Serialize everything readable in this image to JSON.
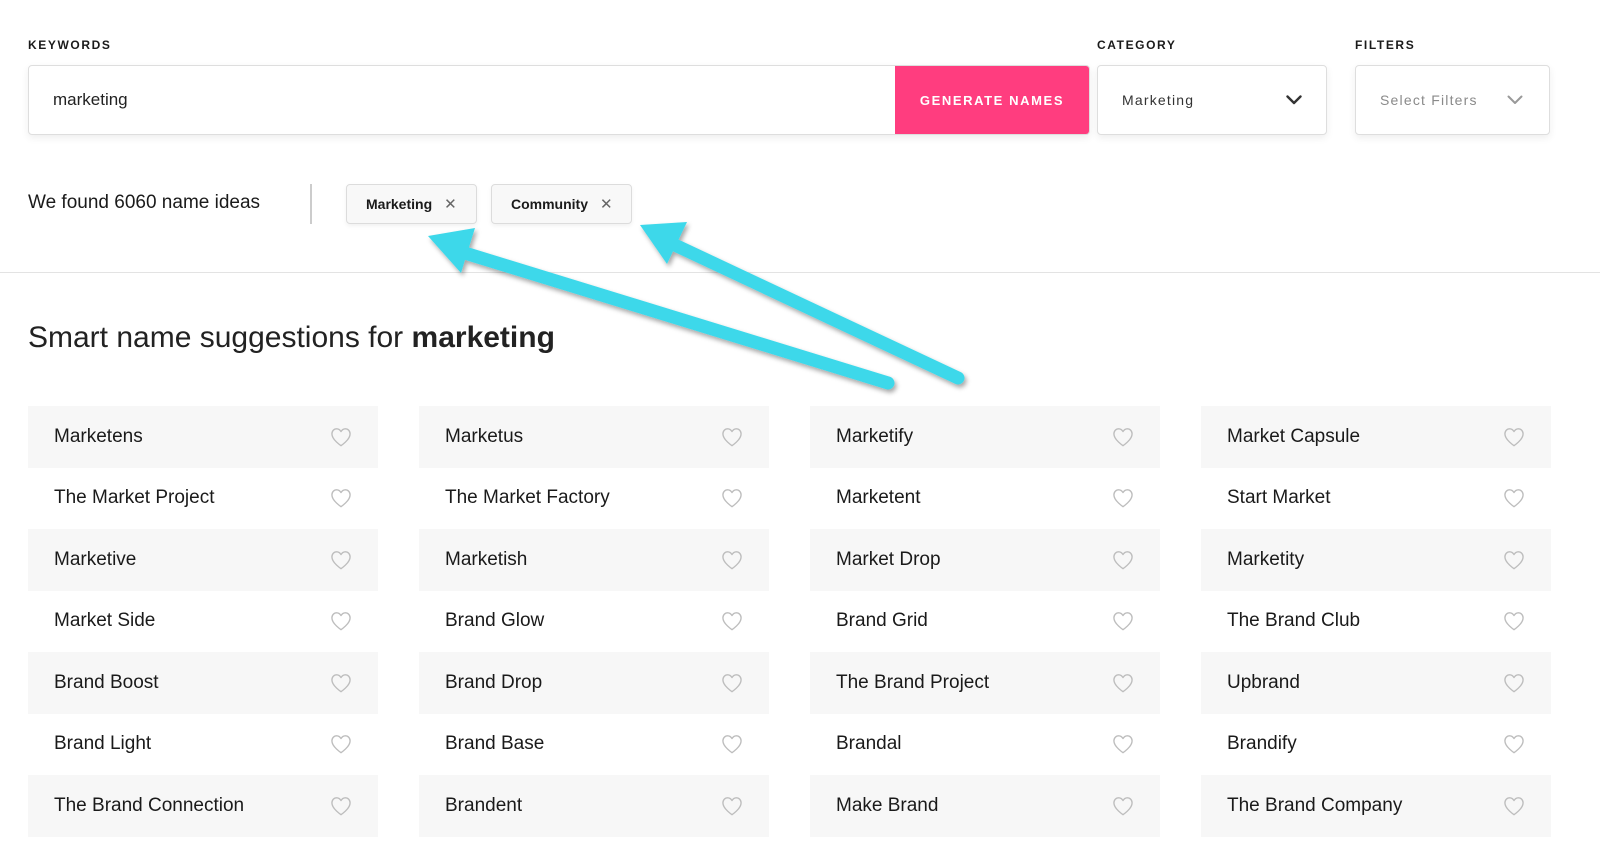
{
  "colors": {
    "accent": "#ff3d7f",
    "arrow": "#3ed8ea",
    "card_shade": "#f7f7f7"
  },
  "keywords": {
    "label": "KEYWORDS",
    "value": "marketing",
    "button": "GENERATE NAMES"
  },
  "category": {
    "label": "CATEGORY",
    "selected": "Marketing",
    "icon": "chevron-down-icon"
  },
  "filters": {
    "label": "FILTERS",
    "placeholder": "Select Filters",
    "icon": "chevron-down-icon"
  },
  "results": {
    "found_text": "We found 6060 name ideas",
    "tags": [
      {
        "label": "Marketing",
        "remove_icon": "close-icon"
      },
      {
        "label": "Community",
        "remove_icon": "close-icon"
      }
    ]
  },
  "heading": {
    "prefix": "Smart name suggestions for",
    "keyword": "marketing"
  },
  "names": [
    [
      "Marketens",
      "Marketus",
      "Marketify",
      "Market Capsule"
    ],
    [
      "The Market Project",
      "The Market Factory",
      "Marketent",
      "Start Market"
    ],
    [
      "Marketive",
      "Marketish",
      "Market Drop",
      "Marketity"
    ],
    [
      "Market Side",
      "Brand Glow",
      "Brand Grid",
      "The Brand Club"
    ],
    [
      "Brand Boost",
      "Brand Drop",
      "The Brand Project",
      "Upbrand"
    ],
    [
      "Brand Light",
      "Brand Base",
      "Brandal",
      "Brandify"
    ],
    [
      "The Brand Connection",
      "Brandent",
      "Make Brand",
      "The Brand Company"
    ]
  ],
  "card_icon": "heart-icon"
}
